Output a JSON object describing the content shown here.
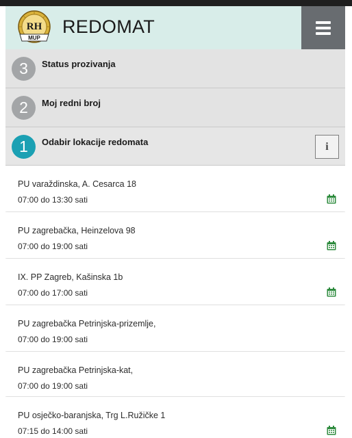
{
  "header": {
    "title": "REDOMAT",
    "logo_text": "RH MUP",
    "accent": "#d8ede9",
    "menu_color": "#686c70"
  },
  "steps": [
    {
      "number": "3",
      "title": "Status prozivanja",
      "active": false
    },
    {
      "number": "2",
      "title": "Moj redni broj",
      "active": false
    },
    {
      "number": "1",
      "title": "Odabir lokacije redomata",
      "active": true,
      "info_icon": "info-icon"
    }
  ],
  "colors": {
    "active_step": "#1ba0b3",
    "inactive_step": "#a3a5a7",
    "calendar_icon": "#2e8b3e"
  },
  "locations": [
    {
      "name": "PU varaždinska, A. Cesarca 18",
      "hours": "07:00 do 13:30 sati",
      "calendar": true
    },
    {
      "name": "PU zagrebačka, Heinzelova 98",
      "hours": "07:00 do 19:00 sati",
      "calendar": true
    },
    {
      "name": "IX. PP Zagreb, Kašinska 1b",
      "hours": "07:00 do 17:00 sati",
      "calendar": true
    },
    {
      "name": "PU zagrebačka Petrinjska-prizemlje,",
      "hours": "07:00 do 19:00 sati",
      "calendar": false
    },
    {
      "name": "PU zagrebačka Petrinjska-kat,",
      "hours": "07:00 do 19:00 sati",
      "calendar": false
    },
    {
      "name": "PU osječko-baranjska, Trg L.Ružičke 1",
      "hours": "07:15 do 14:00 sati",
      "calendar": true
    }
  ]
}
